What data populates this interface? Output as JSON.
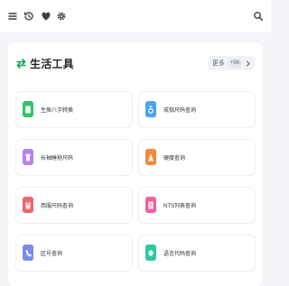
{
  "topbar": {
    "icons": [
      "menu-icon",
      "history-icon",
      "heart-icon",
      "settings-icon",
      "search-icon"
    ]
  },
  "section": {
    "title": "生活工具",
    "icon": "swap-arrows-icon",
    "icon_color": "#18a058",
    "more_label": "更多",
    "more_count": "+96"
  },
  "tools": [
    {
      "label": "生辰八字转换",
      "icon": "card-icon",
      "color": "#32c46a"
    },
    {
      "label": "戒指尺码查询",
      "icon": "ring-icon",
      "color": "#4aa3f0"
    },
    {
      "label": "长袖睡袍尺码",
      "icon": "robe-icon",
      "color": "#b482f0"
    },
    {
      "label": "硬度查询",
      "icon": "cone-icon",
      "color": "#f08a3c"
    },
    {
      "label": "西服尺码查询",
      "icon": "suit-icon",
      "color": "#f0656e"
    },
    {
      "label": "NTS列表查询",
      "icon": "list-icon",
      "color": "#ee5fa3"
    },
    {
      "label": "区号查询",
      "icon": "phone-icon",
      "color": "#7b8cf0"
    },
    {
      "label": "语言代码查询",
      "icon": "globe-icon",
      "color": "#2fc8a5"
    }
  ]
}
